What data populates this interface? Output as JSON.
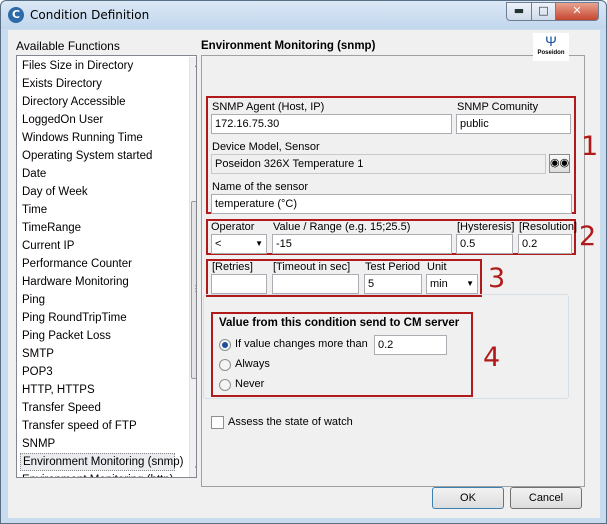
{
  "window": {
    "title": "Condition Definition",
    "app_icon": "C"
  },
  "functions": {
    "label": "Available Functions",
    "items": [
      "Files Size in Directory",
      "Exists Directory",
      "Directory Accessible",
      "LoggedOn User",
      "Windows Running Time",
      "Operating System started",
      "Date",
      "Day of Week",
      "Time",
      "TimeRange",
      "Current IP",
      "Performance Counter",
      "Hardware Monitoring",
      "Ping",
      "Ping RoundTripTime",
      "Ping Packet Loss",
      "SMTP",
      "POP3",
      "HTTP, HTTPS",
      "Transfer Speed",
      "Transfer speed of FTP",
      "SNMP",
      "Environment Monitoring (snmp)",
      "Environment Monitoring (http)"
    ],
    "selected_index": 22
  },
  "panel": {
    "title": "Environment Monitoring (snmp)",
    "logo_text": "Poseidon"
  },
  "group1": {
    "number": "1",
    "agent_label": "SNMP Agent (Host, IP)",
    "agent_value": "172.16.75.30",
    "community_label": "SNMP Comunity",
    "community_value": "public",
    "device_label": "Device Model, Sensor",
    "device_value": "Poseidon 326X Temperature 1",
    "sensor_label": "Name of the sensor",
    "sensor_value": "temperature (°C)"
  },
  "group2": {
    "number": "2",
    "operator_label": "Operator",
    "operator_value": "<",
    "range_label": "Value / Range (e.g. 15;25.5)",
    "range_value": "-15",
    "hysteresis_label": "[Hysteresis]",
    "hysteresis_value": "0.5",
    "resolution_label": "[Resolution]",
    "resolution_value": "0.2"
  },
  "group3": {
    "number": "3",
    "retries_label": "[Retries]",
    "retries_value": "",
    "timeout_label": "[Timeout in sec]",
    "timeout_value": "",
    "period_label": "Test Period",
    "period_value": "5",
    "unit_label": "Unit",
    "unit_value": "min"
  },
  "group4": {
    "number": "4",
    "title": "Value from this condition send to CM server",
    "option_changes": "If value changes more than",
    "changes_value": "0.2",
    "option_always": "Always",
    "option_never": "Never",
    "selected": "changes"
  },
  "assess_label": "Assess the state of watch",
  "assess_checked": false,
  "buttons": {
    "ok": "OK",
    "cancel": "Cancel"
  },
  "colors": {
    "annotation_red": "#b11a1a",
    "title_bar": "#c9dcef"
  }
}
